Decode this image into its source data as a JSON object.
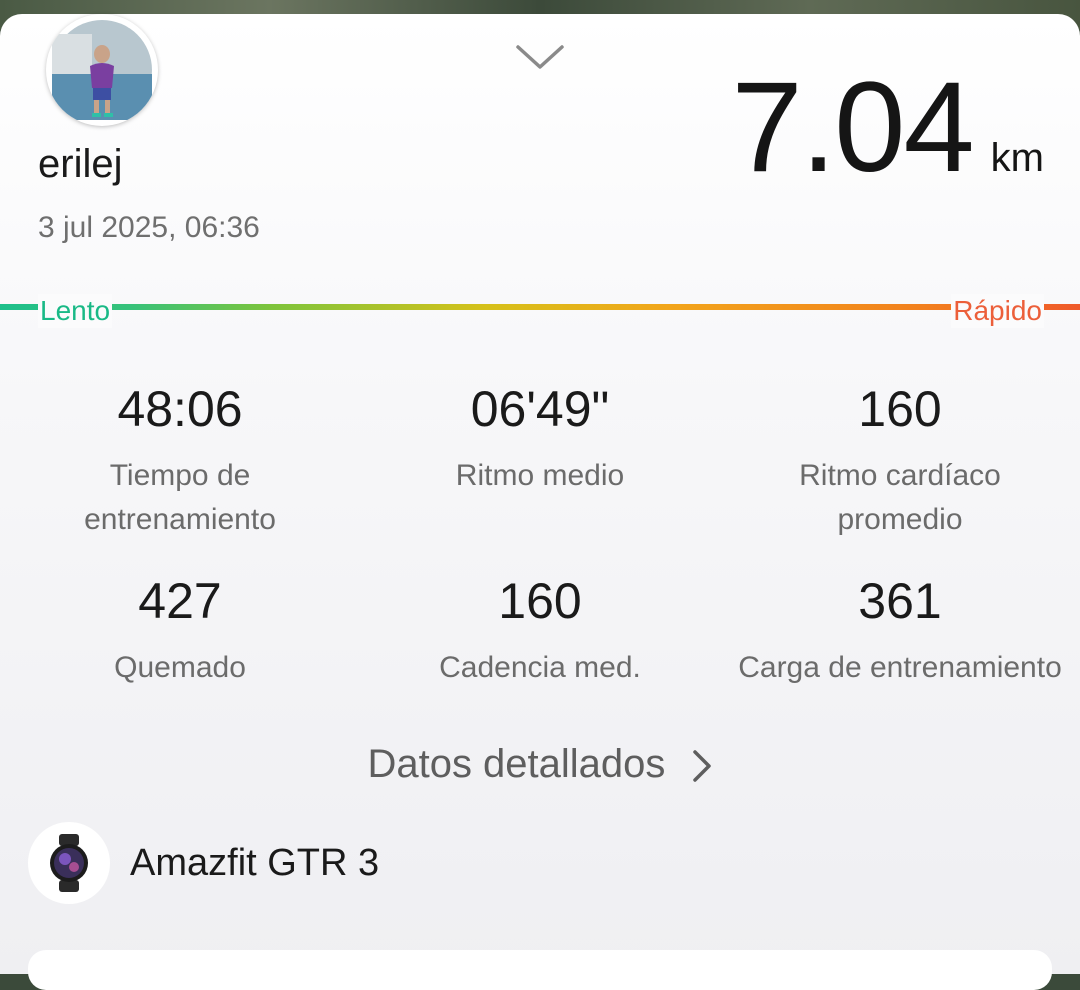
{
  "profile": {
    "username": "erilej",
    "datetime": "3 jul 2025, 06:36"
  },
  "distance": {
    "value": "7.04",
    "unit": "km"
  },
  "pace_scale": {
    "slow_label": "Lento",
    "fast_label": "Rápido"
  },
  "stats": [
    {
      "value": "48:06",
      "label": "Tiempo de entrenamiento"
    },
    {
      "value": "06'49\"",
      "label": "Ritmo medio"
    },
    {
      "value": "160",
      "label": "Ritmo cardíaco promedio"
    },
    {
      "value": "427",
      "label": "Quemado"
    },
    {
      "value": "160",
      "label": "Cadencia med."
    },
    {
      "value": "361",
      "label": "Carga de entrenamiento"
    }
  ],
  "details_link": {
    "label": "Datos detallados"
  },
  "device": {
    "name": "Amazfit GTR 3"
  },
  "icons": {
    "collapse": "chevron-down-icon",
    "details": "chevron-right-icon",
    "device": "smartwatch-icon"
  },
  "colors": {
    "slow": "#19b986",
    "fast": "#ec5f3a",
    "text_primary": "#1a1a1a",
    "text_secondary": "#6b6b6b"
  }
}
